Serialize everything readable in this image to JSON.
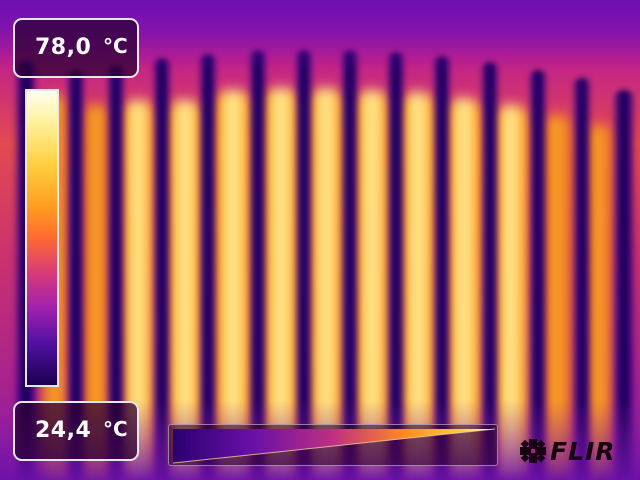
{
  "measurement": {
    "max_value": "78,0",
    "max_unit": "°C",
    "min_value": "24,4",
    "min_unit": "°C"
  },
  "palette": {
    "name": "iron",
    "colors": [
      "#1a0050",
      "#5010a0",
      "#a020b0",
      "#d83a78",
      "#ff6a30",
      "#ff9a20",
      "#ffd040",
      "#fff2a0",
      "#fffff0"
    ]
  },
  "level_span": {
    "level_fraction": 0.5,
    "span_fraction": 1.0
  },
  "brand": {
    "logo_text": "FLIR",
    "logo_icon": "flir-emblem-icon"
  }
}
